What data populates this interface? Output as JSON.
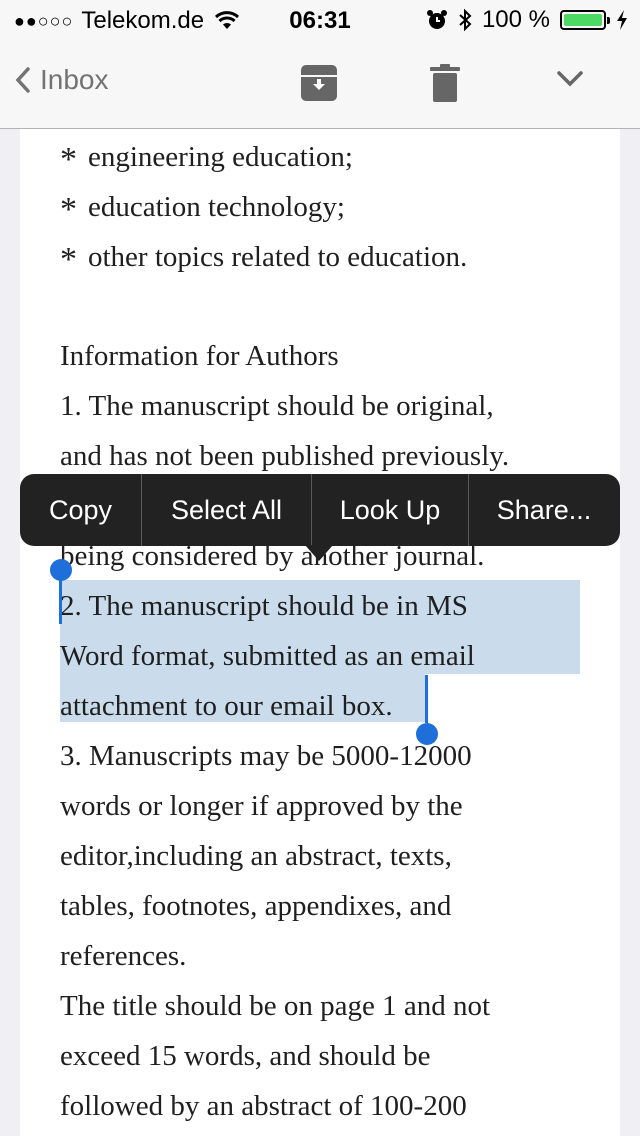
{
  "status_bar": {
    "signal": "●●○○○",
    "carrier": "Telekom.de",
    "time": "06:31",
    "battery_text": "100 %",
    "battery_level": 1.0,
    "battery_color": "#4cd964"
  },
  "nav": {
    "back_label": "Inbox",
    "archive_icon": "archive-icon",
    "trash_icon": "trash-icon",
    "more_icon": "chevron-down-icon"
  },
  "body_lines": {
    "l1": "engineering education;",
    "l2": "education technology;",
    "l3": "other topics related to education.",
    "l4": "Information for Authors",
    "l5": "1. The manuscript should be original,",
    "l6": "and has not been published previously.",
    "l7": "being considered by another journal.",
    "l8": "2. The manuscript should be in MS",
    "l9": "Word format, submitted as an email",
    "l10": "attachment to our email box.",
    "l11": "3. Manuscripts may be 5000-12000",
    "l12": "words or longer if approved by the",
    "l13": "editor,including an abstract, texts,",
    "l14": "tables, footnotes, appendixes, and",
    "l15": "references.",
    "l16": "The title should be on page 1 and not",
    "l17": "exceed 15 words, and should be",
    "l18": "followed by an abstract of 100-200"
  },
  "bullet_char": "*",
  "context_menu": {
    "copy": "Copy",
    "select_all": "Select All",
    "look_up": "Look Up",
    "share": "Share..."
  },
  "colors": {
    "selection": "#cadcec",
    "handle": "#1e6fd9",
    "menu_bg": "#222222"
  }
}
